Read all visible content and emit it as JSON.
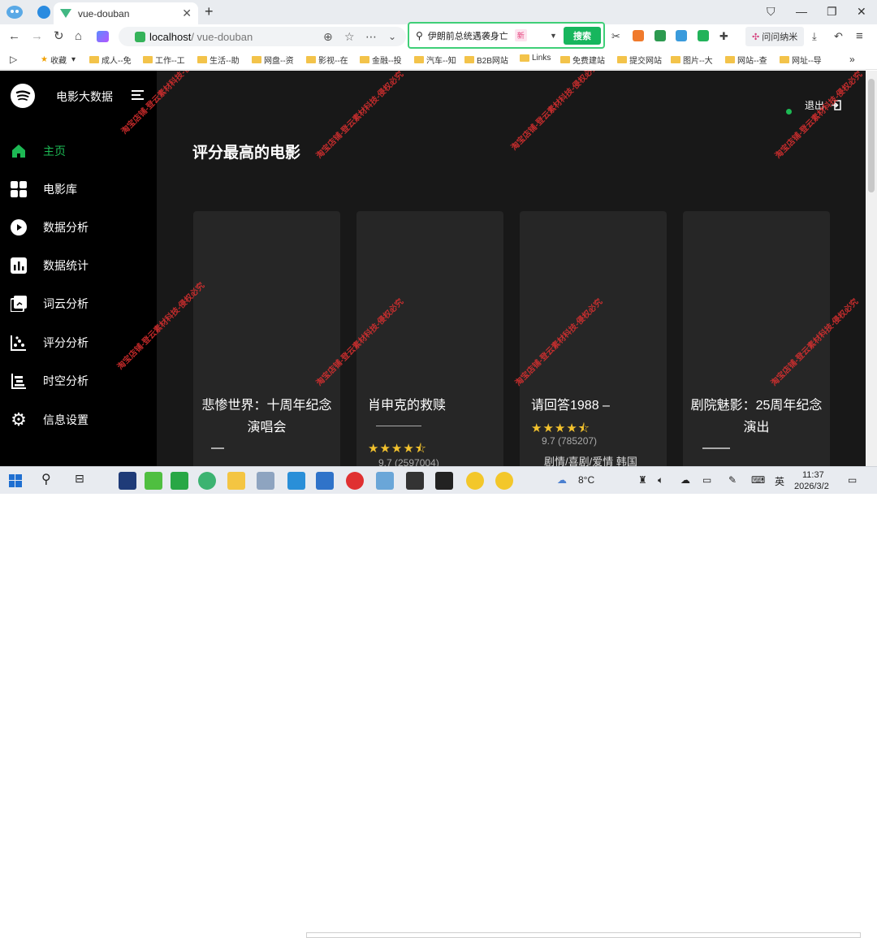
{
  "browser": {
    "tab_title": "vue-douban",
    "tab_close": "✕",
    "new_tab": "+",
    "address_host": "localhost",
    "address_path": " / vue-douban",
    "search_query": "伊朗前总统遇袭身亡",
    "search_new_badge": "新",
    "search_button": "搜索",
    "ask_button": "问问纳米",
    "bookmarks": [
      "收藏",
      "成人--免",
      "工作--工",
      "生活--助",
      "网盘--资",
      "影视--在",
      "金融--投",
      "汽车--知",
      "B2B网站",
      "Links",
      "免费建站",
      "提交网站",
      "图片--大",
      "网站--查",
      "网址--导"
    ]
  },
  "app": {
    "brand": "电影大数据",
    "logout": "退出",
    "menu": [
      {
        "label": "主页",
        "icon": "home-icon",
        "active": true
      },
      {
        "label": "电影库",
        "icon": "grid-icon",
        "active": false
      },
      {
        "label": "数据分析",
        "icon": "play-circle-icon",
        "active": false
      },
      {
        "label": "数据统计",
        "icon": "bar-chart-icon",
        "active": false
      },
      {
        "label": "词云分析",
        "icon": "cloud-icon",
        "active": false
      },
      {
        "label": "评分分析",
        "icon": "scatter-icon",
        "active": false
      },
      {
        "label": "时空分析",
        "icon": "timeline-icon",
        "active": false
      },
      {
        "label": "信息设置",
        "icon": "gear-icon",
        "active": false
      }
    ],
    "section_title": "评分最高的电影",
    "cards": [
      {
        "title": "悲惨世界：十周年纪念演唱会",
        "stars": "",
        "rating": "",
        "tags": ""
      },
      {
        "title": "肖申克的救赎",
        "stars": "★★★★⯪",
        "rating": "9.7 (2597004)",
        "tags": ""
      },
      {
        "title": "请回答1988 –",
        "stars": "★★★★⯪",
        "rating": "9.7 (785207)",
        "tags": "剧情/喜剧/爱情 韩国"
      },
      {
        "title": "剧院魅影：25周年纪念演出",
        "stars": "",
        "rating": "",
        "tags": ""
      }
    ]
  },
  "watermark": "淘宝店铺-登云素材科技-侵权必究",
  "taskbar": {
    "weather": "8°C",
    "lang": "英",
    "time": "11:37",
    "date": "2026/3/2"
  },
  "colors": {
    "accent": "#1db954",
    "star": "#f3c22d",
    "search_green": "#17b65d"
  }
}
